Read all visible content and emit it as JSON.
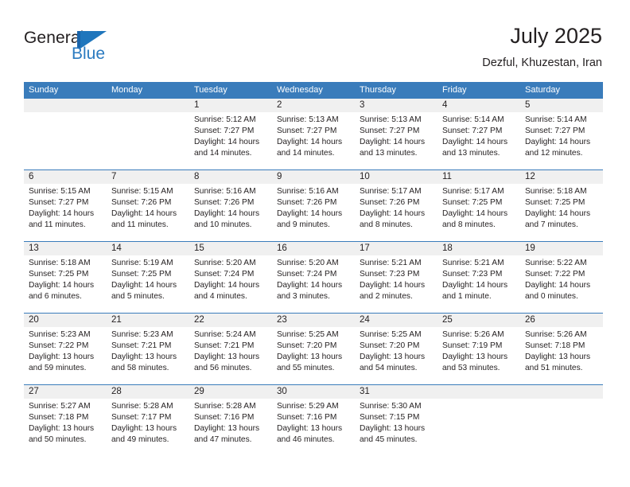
{
  "brand": {
    "name_part1": "General",
    "name_part2": "Blue"
  },
  "header": {
    "title": "July 2025",
    "subtitle": "Dezful, Khuzestan, Iran"
  },
  "colors": {
    "header_blue": "#3a7cbb",
    "brand_blue": "#2a7ac0",
    "date_band": "#f0f0f0",
    "text": "#231f20"
  },
  "weekdays": [
    "Sunday",
    "Monday",
    "Tuesday",
    "Wednesday",
    "Thursday",
    "Friday",
    "Saturday"
  ],
  "weeks": [
    [
      {
        "day": "",
        "sunrise": "",
        "sunset": "",
        "daylight_line1": "",
        "daylight_line2": ""
      },
      {
        "day": "",
        "sunrise": "",
        "sunset": "",
        "daylight_line1": "",
        "daylight_line2": ""
      },
      {
        "day": "1",
        "sunrise": "Sunrise: 5:12 AM",
        "sunset": "Sunset: 7:27 PM",
        "daylight_line1": "Daylight: 14 hours",
        "daylight_line2": "and 14 minutes."
      },
      {
        "day": "2",
        "sunrise": "Sunrise: 5:13 AM",
        "sunset": "Sunset: 7:27 PM",
        "daylight_line1": "Daylight: 14 hours",
        "daylight_line2": "and 14 minutes."
      },
      {
        "day": "3",
        "sunrise": "Sunrise: 5:13 AM",
        "sunset": "Sunset: 7:27 PM",
        "daylight_line1": "Daylight: 14 hours",
        "daylight_line2": "and 13 minutes."
      },
      {
        "day": "4",
        "sunrise": "Sunrise: 5:14 AM",
        "sunset": "Sunset: 7:27 PM",
        "daylight_line1": "Daylight: 14 hours",
        "daylight_line2": "and 13 minutes."
      },
      {
        "day": "5",
        "sunrise": "Sunrise: 5:14 AM",
        "sunset": "Sunset: 7:27 PM",
        "daylight_line1": "Daylight: 14 hours",
        "daylight_line2": "and 12 minutes."
      }
    ],
    [
      {
        "day": "6",
        "sunrise": "Sunrise: 5:15 AM",
        "sunset": "Sunset: 7:27 PM",
        "daylight_line1": "Daylight: 14 hours",
        "daylight_line2": "and 11 minutes."
      },
      {
        "day": "7",
        "sunrise": "Sunrise: 5:15 AM",
        "sunset": "Sunset: 7:26 PM",
        "daylight_line1": "Daylight: 14 hours",
        "daylight_line2": "and 11 minutes."
      },
      {
        "day": "8",
        "sunrise": "Sunrise: 5:16 AM",
        "sunset": "Sunset: 7:26 PM",
        "daylight_line1": "Daylight: 14 hours",
        "daylight_line2": "and 10 minutes."
      },
      {
        "day": "9",
        "sunrise": "Sunrise: 5:16 AM",
        "sunset": "Sunset: 7:26 PM",
        "daylight_line1": "Daylight: 14 hours",
        "daylight_line2": "and 9 minutes."
      },
      {
        "day": "10",
        "sunrise": "Sunrise: 5:17 AM",
        "sunset": "Sunset: 7:26 PM",
        "daylight_line1": "Daylight: 14 hours",
        "daylight_line2": "and 8 minutes."
      },
      {
        "day": "11",
        "sunrise": "Sunrise: 5:17 AM",
        "sunset": "Sunset: 7:25 PM",
        "daylight_line1": "Daylight: 14 hours",
        "daylight_line2": "and 8 minutes."
      },
      {
        "day": "12",
        "sunrise": "Sunrise: 5:18 AM",
        "sunset": "Sunset: 7:25 PM",
        "daylight_line1": "Daylight: 14 hours",
        "daylight_line2": "and 7 minutes."
      }
    ],
    [
      {
        "day": "13",
        "sunrise": "Sunrise: 5:18 AM",
        "sunset": "Sunset: 7:25 PM",
        "daylight_line1": "Daylight: 14 hours",
        "daylight_line2": "and 6 minutes."
      },
      {
        "day": "14",
        "sunrise": "Sunrise: 5:19 AM",
        "sunset": "Sunset: 7:25 PM",
        "daylight_line1": "Daylight: 14 hours",
        "daylight_line2": "and 5 minutes."
      },
      {
        "day": "15",
        "sunrise": "Sunrise: 5:20 AM",
        "sunset": "Sunset: 7:24 PM",
        "daylight_line1": "Daylight: 14 hours",
        "daylight_line2": "and 4 minutes."
      },
      {
        "day": "16",
        "sunrise": "Sunrise: 5:20 AM",
        "sunset": "Sunset: 7:24 PM",
        "daylight_line1": "Daylight: 14 hours",
        "daylight_line2": "and 3 minutes."
      },
      {
        "day": "17",
        "sunrise": "Sunrise: 5:21 AM",
        "sunset": "Sunset: 7:23 PM",
        "daylight_line1": "Daylight: 14 hours",
        "daylight_line2": "and 2 minutes."
      },
      {
        "day": "18",
        "sunrise": "Sunrise: 5:21 AM",
        "sunset": "Sunset: 7:23 PM",
        "daylight_line1": "Daylight: 14 hours",
        "daylight_line2": "and 1 minute."
      },
      {
        "day": "19",
        "sunrise": "Sunrise: 5:22 AM",
        "sunset": "Sunset: 7:22 PM",
        "daylight_line1": "Daylight: 14 hours",
        "daylight_line2": "and 0 minutes."
      }
    ],
    [
      {
        "day": "20",
        "sunrise": "Sunrise: 5:23 AM",
        "sunset": "Sunset: 7:22 PM",
        "daylight_line1": "Daylight: 13 hours",
        "daylight_line2": "and 59 minutes."
      },
      {
        "day": "21",
        "sunrise": "Sunrise: 5:23 AM",
        "sunset": "Sunset: 7:21 PM",
        "daylight_line1": "Daylight: 13 hours",
        "daylight_line2": "and 58 minutes."
      },
      {
        "day": "22",
        "sunrise": "Sunrise: 5:24 AM",
        "sunset": "Sunset: 7:21 PM",
        "daylight_line1": "Daylight: 13 hours",
        "daylight_line2": "and 56 minutes."
      },
      {
        "day": "23",
        "sunrise": "Sunrise: 5:25 AM",
        "sunset": "Sunset: 7:20 PM",
        "daylight_line1": "Daylight: 13 hours",
        "daylight_line2": "and 55 minutes."
      },
      {
        "day": "24",
        "sunrise": "Sunrise: 5:25 AM",
        "sunset": "Sunset: 7:20 PM",
        "daylight_line1": "Daylight: 13 hours",
        "daylight_line2": "and 54 minutes."
      },
      {
        "day": "25",
        "sunrise": "Sunrise: 5:26 AM",
        "sunset": "Sunset: 7:19 PM",
        "daylight_line1": "Daylight: 13 hours",
        "daylight_line2": "and 53 minutes."
      },
      {
        "day": "26",
        "sunrise": "Sunrise: 5:26 AM",
        "sunset": "Sunset: 7:18 PM",
        "daylight_line1": "Daylight: 13 hours",
        "daylight_line2": "and 51 minutes."
      }
    ],
    [
      {
        "day": "27",
        "sunrise": "Sunrise: 5:27 AM",
        "sunset": "Sunset: 7:18 PM",
        "daylight_line1": "Daylight: 13 hours",
        "daylight_line2": "and 50 minutes."
      },
      {
        "day": "28",
        "sunrise": "Sunrise: 5:28 AM",
        "sunset": "Sunset: 7:17 PM",
        "daylight_line1": "Daylight: 13 hours",
        "daylight_line2": "and 49 minutes."
      },
      {
        "day": "29",
        "sunrise": "Sunrise: 5:28 AM",
        "sunset": "Sunset: 7:16 PM",
        "daylight_line1": "Daylight: 13 hours",
        "daylight_line2": "and 47 minutes."
      },
      {
        "day": "30",
        "sunrise": "Sunrise: 5:29 AM",
        "sunset": "Sunset: 7:16 PM",
        "daylight_line1": "Daylight: 13 hours",
        "daylight_line2": "and 46 minutes."
      },
      {
        "day": "31",
        "sunrise": "Sunrise: 5:30 AM",
        "sunset": "Sunset: 7:15 PM",
        "daylight_line1": "Daylight: 13 hours",
        "daylight_line2": "and 45 minutes."
      },
      {
        "day": "",
        "sunrise": "",
        "sunset": "",
        "daylight_line1": "",
        "daylight_line2": ""
      },
      {
        "day": "",
        "sunrise": "",
        "sunset": "",
        "daylight_line1": "",
        "daylight_line2": ""
      }
    ]
  ]
}
